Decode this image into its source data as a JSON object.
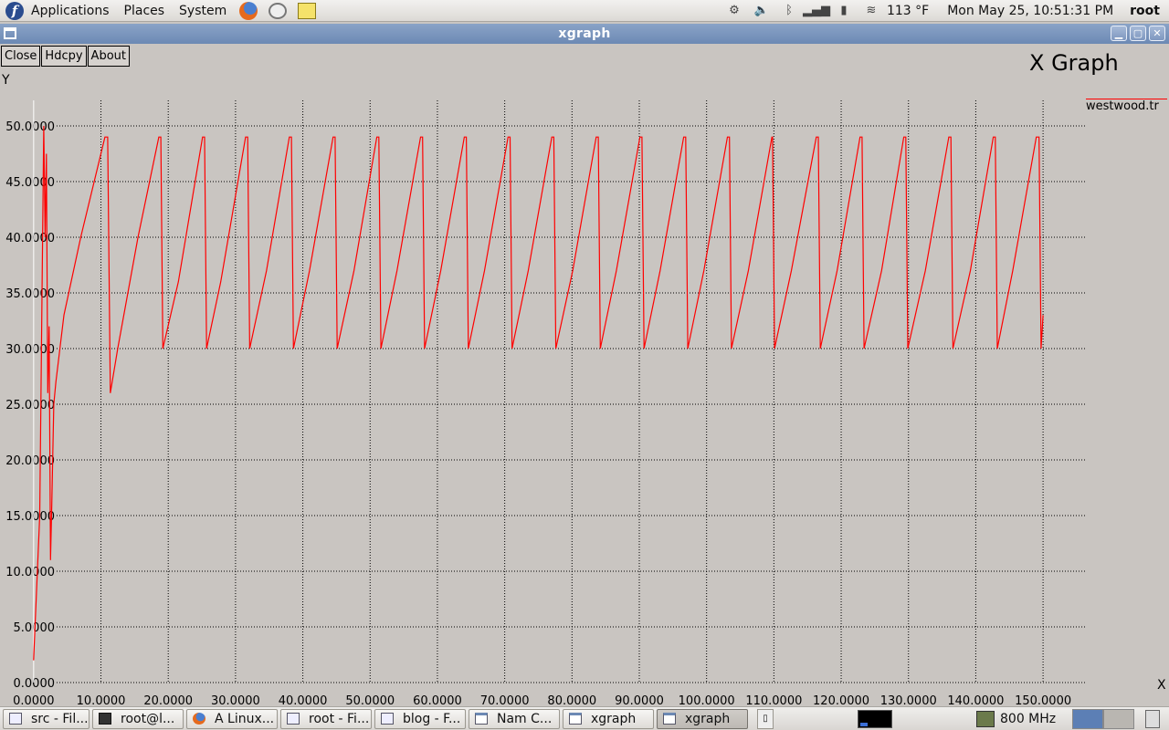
{
  "top_panel": {
    "menus": [
      "Applications",
      "Places",
      "System"
    ],
    "temperature": "113 °F",
    "clock": "Mon May 25, 10:51:31 PM",
    "user": "root",
    "icons": [
      "fedora-icon",
      "firefox-icon",
      "mail-icon",
      "notes-icon",
      "updates-icon",
      "volume-icon",
      "bluetooth-icon",
      "network-signal-icon",
      "power-icon",
      "weather-icon"
    ]
  },
  "window": {
    "title": "xgraph",
    "buttons": {
      "close": "Close",
      "hardcopy": "Hdcpy",
      "about": "About"
    },
    "graph_title": "X Graph",
    "legend": [
      {
        "name": "westwood.tr",
        "color": "#ff0000"
      }
    ]
  },
  "chart_data": {
    "type": "line",
    "title": "X Graph",
    "xlabel": "X",
    "ylabel": "Y",
    "xlim": [
      -5.0,
      156.5
    ],
    "ylim": [
      0,
      50
    ],
    "x_ticks": [
      0,
      10,
      20,
      30,
      40,
      50,
      60,
      70,
      80,
      90,
      100,
      110,
      120,
      130,
      140,
      150
    ],
    "x_tick_labels": [
      "0.0000",
      "10.0000",
      "20.0000",
      "30.0000",
      "40.0000",
      "50.0000",
      "60.0000",
      "70.0000",
      "80.0000",
      "90.0000",
      "100.0000",
      "110.0000",
      "120.0000",
      "130.0000",
      "140.0000",
      "150.0000"
    ],
    "y_ticks": [
      0,
      5,
      10,
      15,
      20,
      25,
      30,
      35,
      40,
      45,
      50
    ],
    "y_tick_labels": [
      "0.0000",
      "5.0000",
      "10.0000",
      "15.0000",
      "20.0000",
      "25.0000",
      "30.0000",
      "35.0000",
      "40.0000",
      "45.0000",
      "50.0000"
    ],
    "grid": true,
    "legend_position": "top-right",
    "series": [
      {
        "name": "westwood.tr",
        "color": "#ff0000",
        "x": [
          0.0,
          0.9,
          1.5,
          1.7,
          1.9,
          2.1,
          2.3,
          2.5,
          2.7,
          3.0,
          3.3,
          4.5,
          7.0,
          10.6,
          11.0,
          11.4,
          12.5,
          15.5,
          18.6,
          18.9,
          19.2,
          21.5,
          25.1,
          25.4,
          25.7,
          27.8,
          31.5,
          31.8,
          32.1,
          34.6,
          38.0,
          38.3,
          38.6,
          41.0,
          44.5,
          44.8,
          45.1,
          47.6,
          51.0,
          51.3,
          51.6,
          54.0,
          57.5,
          57.8,
          58.1,
          60.5,
          64.0,
          64.3,
          64.6,
          67.0,
          70.5,
          70.8,
          71.1,
          73.5,
          77.0,
          77.3,
          77.6,
          80.1,
          83.6,
          83.9,
          84.2,
          86.6,
          90.1,
          90.4,
          90.7,
          93.1,
          96.6,
          96.9,
          97.2,
          99.6,
          103.1,
          103.4,
          103.7,
          106.2,
          109.7,
          109.8,
          110.1,
          112.6,
          116.3,
          116.6,
          116.9,
          119.4,
          122.8,
          123.1,
          123.4,
          126.0,
          129.3,
          129.6,
          129.9,
          132.5,
          136.0,
          136.3,
          136.6,
          139.2,
          142.6,
          142.9,
          143.2,
          145.5,
          149.0,
          149.4,
          149.7,
          150.0
        ],
        "y": [
          2.0,
          15.0,
          50.0,
          40.0,
          47.5,
          26.0,
          32.0,
          11.0,
          16.0,
          25.0,
          27.0,
          33.0,
          40.0,
          49.0,
          49.0,
          26.0,
          30.0,
          40.0,
          49.0,
          49.0,
          30.0,
          36.0,
          49.0,
          49.0,
          30.0,
          36.0,
          49.0,
          49.0,
          30.0,
          37.0,
          49.0,
          49.0,
          30.0,
          37.0,
          49.0,
          49.0,
          30.0,
          37.0,
          49.0,
          49.0,
          30.0,
          37.0,
          49.0,
          49.0,
          30.0,
          37.0,
          49.0,
          49.0,
          30.0,
          37.0,
          49.0,
          49.0,
          30.0,
          37.0,
          49.0,
          49.0,
          30.0,
          37.0,
          49.0,
          49.0,
          30.0,
          37.0,
          49.0,
          49.0,
          30.0,
          37.0,
          49.0,
          49.0,
          30.0,
          37.0,
          49.0,
          49.0,
          30.0,
          37.0,
          49.0,
          49.0,
          30.0,
          37.0,
          49.0,
          49.0,
          30.0,
          37.0,
          49.0,
          49.0,
          30.0,
          37.0,
          49.0,
          49.0,
          30.0,
          37.0,
          49.0,
          49.0,
          30.0,
          37.0,
          49.0,
          49.0,
          30.0,
          37.0,
          49.0,
          49.0,
          30.0,
          33.0
        ]
      }
    ]
  },
  "taskbar": {
    "tasks": [
      {
        "label": "src - Fil...",
        "icon": "file-manager-icon",
        "active": false
      },
      {
        "label": "root@l...",
        "icon": "terminal-icon",
        "active": false
      },
      {
        "label": "A Linux...",
        "icon": "firefox-icon",
        "active": false
      },
      {
        "label": "root - Fi...",
        "icon": "file-manager-icon",
        "active": false
      },
      {
        "label": "blog - F...",
        "icon": "file-manager-icon",
        "active": false
      },
      {
        "label": "Nam C...",
        "icon": "window-icon",
        "active": false
      },
      {
        "label": "xgraph",
        "icon": "window-icon",
        "active": false
      },
      {
        "label": "xgraph",
        "icon": "window-icon",
        "active": true
      }
    ],
    "cpu_frequency": "800 MHz"
  }
}
